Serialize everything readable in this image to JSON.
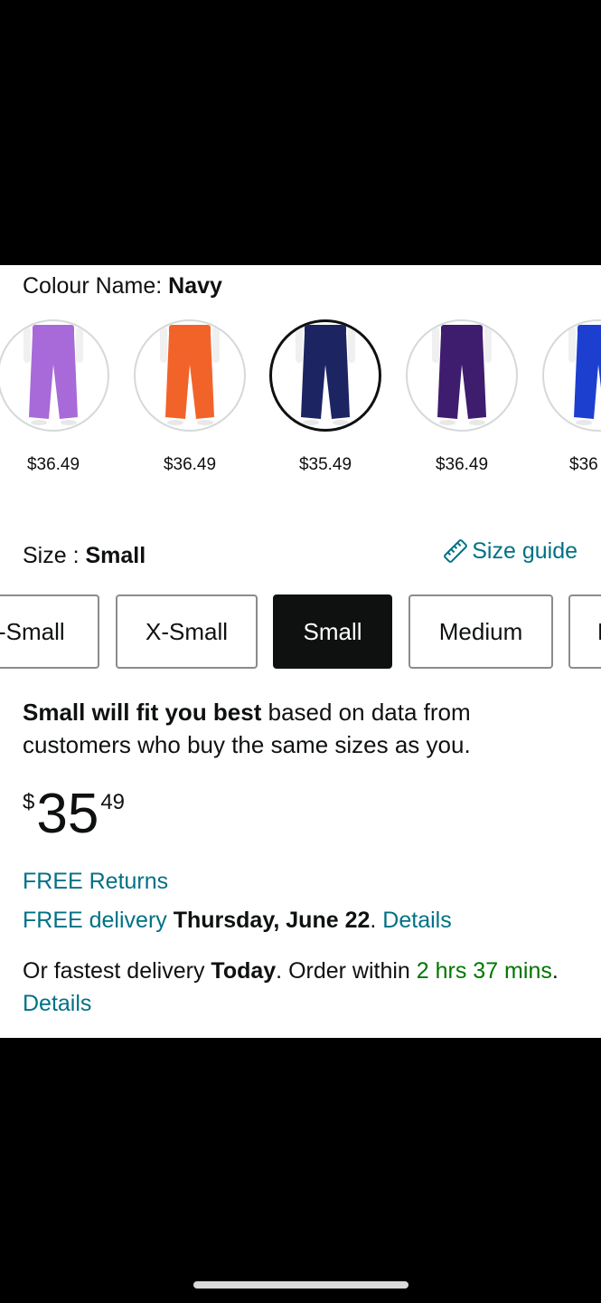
{
  "colour": {
    "label": "Colour Name: ",
    "value": "Navy"
  },
  "swatches": [
    {
      "color": "#a86ad8",
      "price": "$36.49",
      "selected": false
    },
    {
      "color": "#f2632a",
      "price": "$36.49",
      "selected": false
    },
    {
      "color": "#1c2461",
      "price": "$35.49",
      "selected": true
    },
    {
      "color": "#3e1c6e",
      "price": "$36.49",
      "selected": false
    },
    {
      "color": "#1d3fcf",
      "price": "$36",
      "selected": false
    }
  ],
  "size": {
    "label": "Size : ",
    "value": "Small",
    "guide_label": "Size guide"
  },
  "size_options": [
    "-Small",
    "X-Small",
    "Small",
    "Medium",
    "L"
  ],
  "fit": {
    "bold": "Small will fit you best",
    "rest": " based on data from customers who buy the same sizes as you."
  },
  "price": {
    "symbol": "$",
    "whole": "35",
    "fraction": "49"
  },
  "returns": "FREE Returns",
  "delivery": {
    "prefix": "FREE delivery",
    "date": "Thursday, June 22",
    "period": ".",
    "details": "Details"
  },
  "fastest": {
    "prefix": "Or fastest delivery ",
    "when": "Today",
    "middle": ". Order within ",
    "countdown": "2 hrs 37 mins",
    "period": ". ",
    "details": "Details"
  }
}
